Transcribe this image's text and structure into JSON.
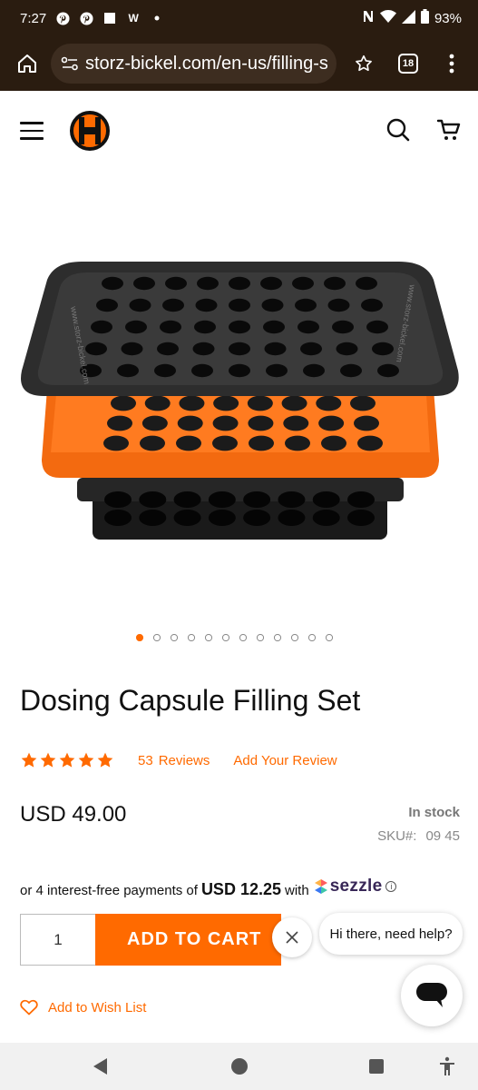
{
  "status_bar": {
    "time": "7:27",
    "notification_icons": [
      "pinterest-icon",
      "pinterest-icon",
      "square-icon",
      "w-icon",
      "dot-icon"
    ],
    "w_glyph": "W",
    "battery": "93%"
  },
  "browser": {
    "url": "storz-bickel.com/en-us/filling-s",
    "tab_count": "18"
  },
  "product": {
    "title": "Dosing Capsule Filling Set",
    "rating_stars": 5,
    "reviews_count": "53",
    "reviews_label": "Reviews",
    "add_review": "Add Your Review",
    "price": "USD 49.00",
    "stock": "In stock",
    "sku_label": "SKU#:",
    "sku_value": "09 45",
    "carousel_total": 12,
    "carousel_active": 1
  },
  "sezzle": {
    "prefix": "or 4 interest-free payments of",
    "amount": "USD 12.25",
    "with": "with",
    "brand": "sezzle",
    "info": "i"
  },
  "cart": {
    "quantity": "1",
    "add_to_cart": "ADD TO CART"
  },
  "chat": {
    "greeting": "Hi there, need help?"
  },
  "wishlist": {
    "label": "Add to Wish List"
  },
  "colors": {
    "accent": "#ff6a00",
    "browser_bg": "#2a1c10",
    "sezzle_purple": "#382757"
  }
}
